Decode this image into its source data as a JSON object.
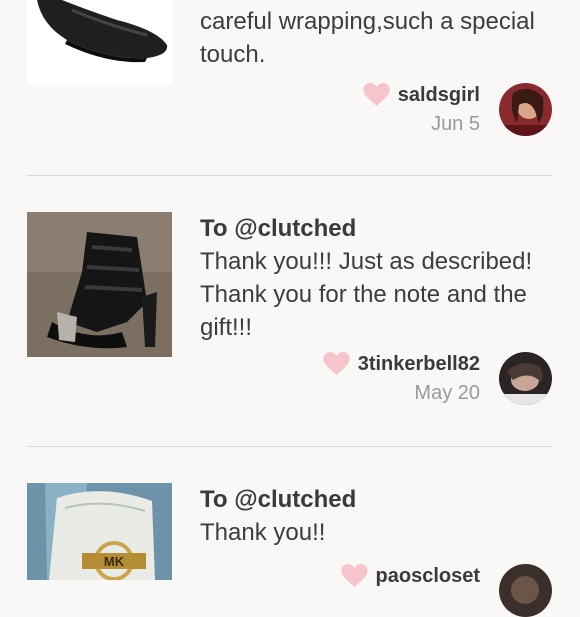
{
  "reviews": [
    {
      "to": "",
      "text": "careful wrapping,such a special touch.",
      "username": "saldsgirl",
      "date": "Jun 5",
      "thumb_icon": "black-loafer-shoe",
      "avatar_icon": "user-avatar"
    },
    {
      "to": "To @clutched",
      "text": "Thank you!!! Just as described! Thank you for the note and the gift!!!",
      "username": "3tinkerbell82",
      "date": "May 20",
      "thumb_icon": "black-heeled-sandal",
      "avatar_icon": "user-avatar"
    },
    {
      "to": "To @clutched",
      "text": "Thank you!!",
      "username": "paoscloset",
      "date": "",
      "thumb_icon": "mk-flat-shoe",
      "avatar_icon": "user-avatar"
    }
  ],
  "colors": {
    "heart": "#f6c5cb",
    "background": "#f9f8f7",
    "divider": "#dcdad7"
  }
}
